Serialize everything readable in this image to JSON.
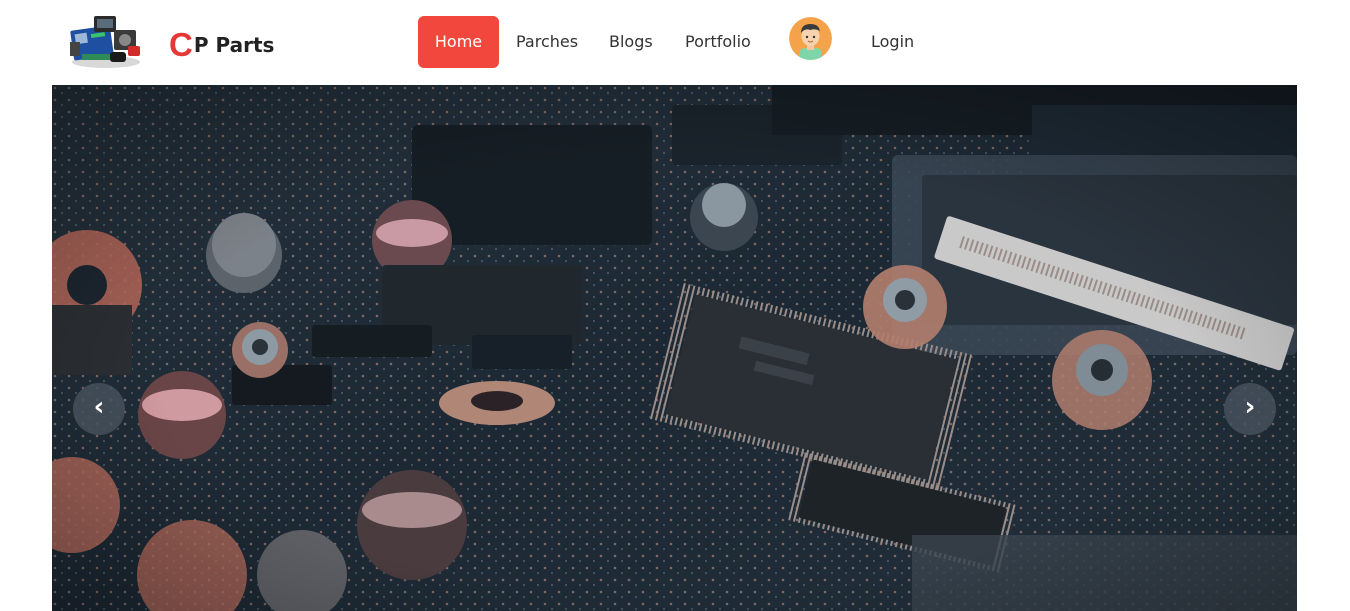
{
  "brand": {
    "logo_letter": "C",
    "name": "P Parts",
    "logo_icon": "computer-parts-image",
    "accent_color": "#e53935"
  },
  "nav": {
    "items": [
      {
        "label": "Home",
        "active": true,
        "highlight_color": "#f2473c"
      },
      {
        "label": "Parches",
        "active": false
      },
      {
        "label": "Blogs",
        "active": false
      },
      {
        "label": "Portfolio",
        "active": false
      }
    ],
    "avatar_icon": "user-avatar-icon",
    "login_label": "Login"
  },
  "carousel": {
    "image": "circuit-board-photo",
    "prev_glyph": "‹",
    "next_glyph": "›"
  }
}
